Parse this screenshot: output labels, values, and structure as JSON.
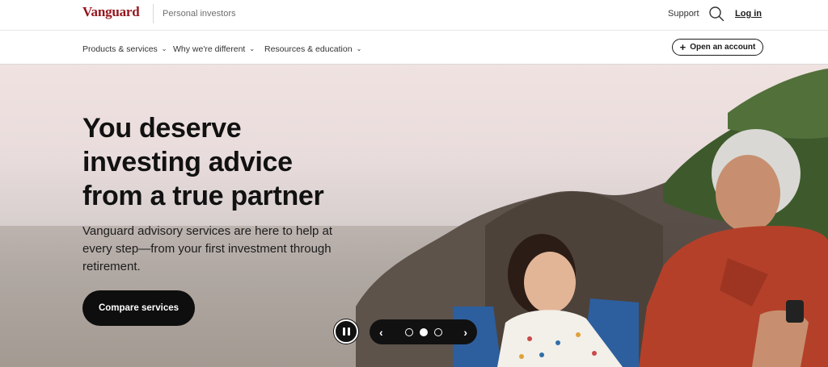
{
  "header": {
    "logo": "Vanguard",
    "tagline": "Personal investors",
    "support": "Support",
    "login": "Log in"
  },
  "nav": {
    "items": [
      {
        "label": "Products & services"
      },
      {
        "label": "Why we're different"
      },
      {
        "label": "Resources & education"
      }
    ],
    "open_account": "Open an account"
  },
  "hero": {
    "title_lines": [
      "You deserve",
      "investing advice",
      "from a true partner"
    ],
    "subtitle": "Vanguard advisory services are here to help at every step—from your first investment through retirement.",
    "cta": "Compare services"
  },
  "carousel": {
    "slide_count": 3,
    "active_slide": 2
  },
  "colors": {
    "brand": "#96151d",
    "button": "#0e0e0e"
  }
}
